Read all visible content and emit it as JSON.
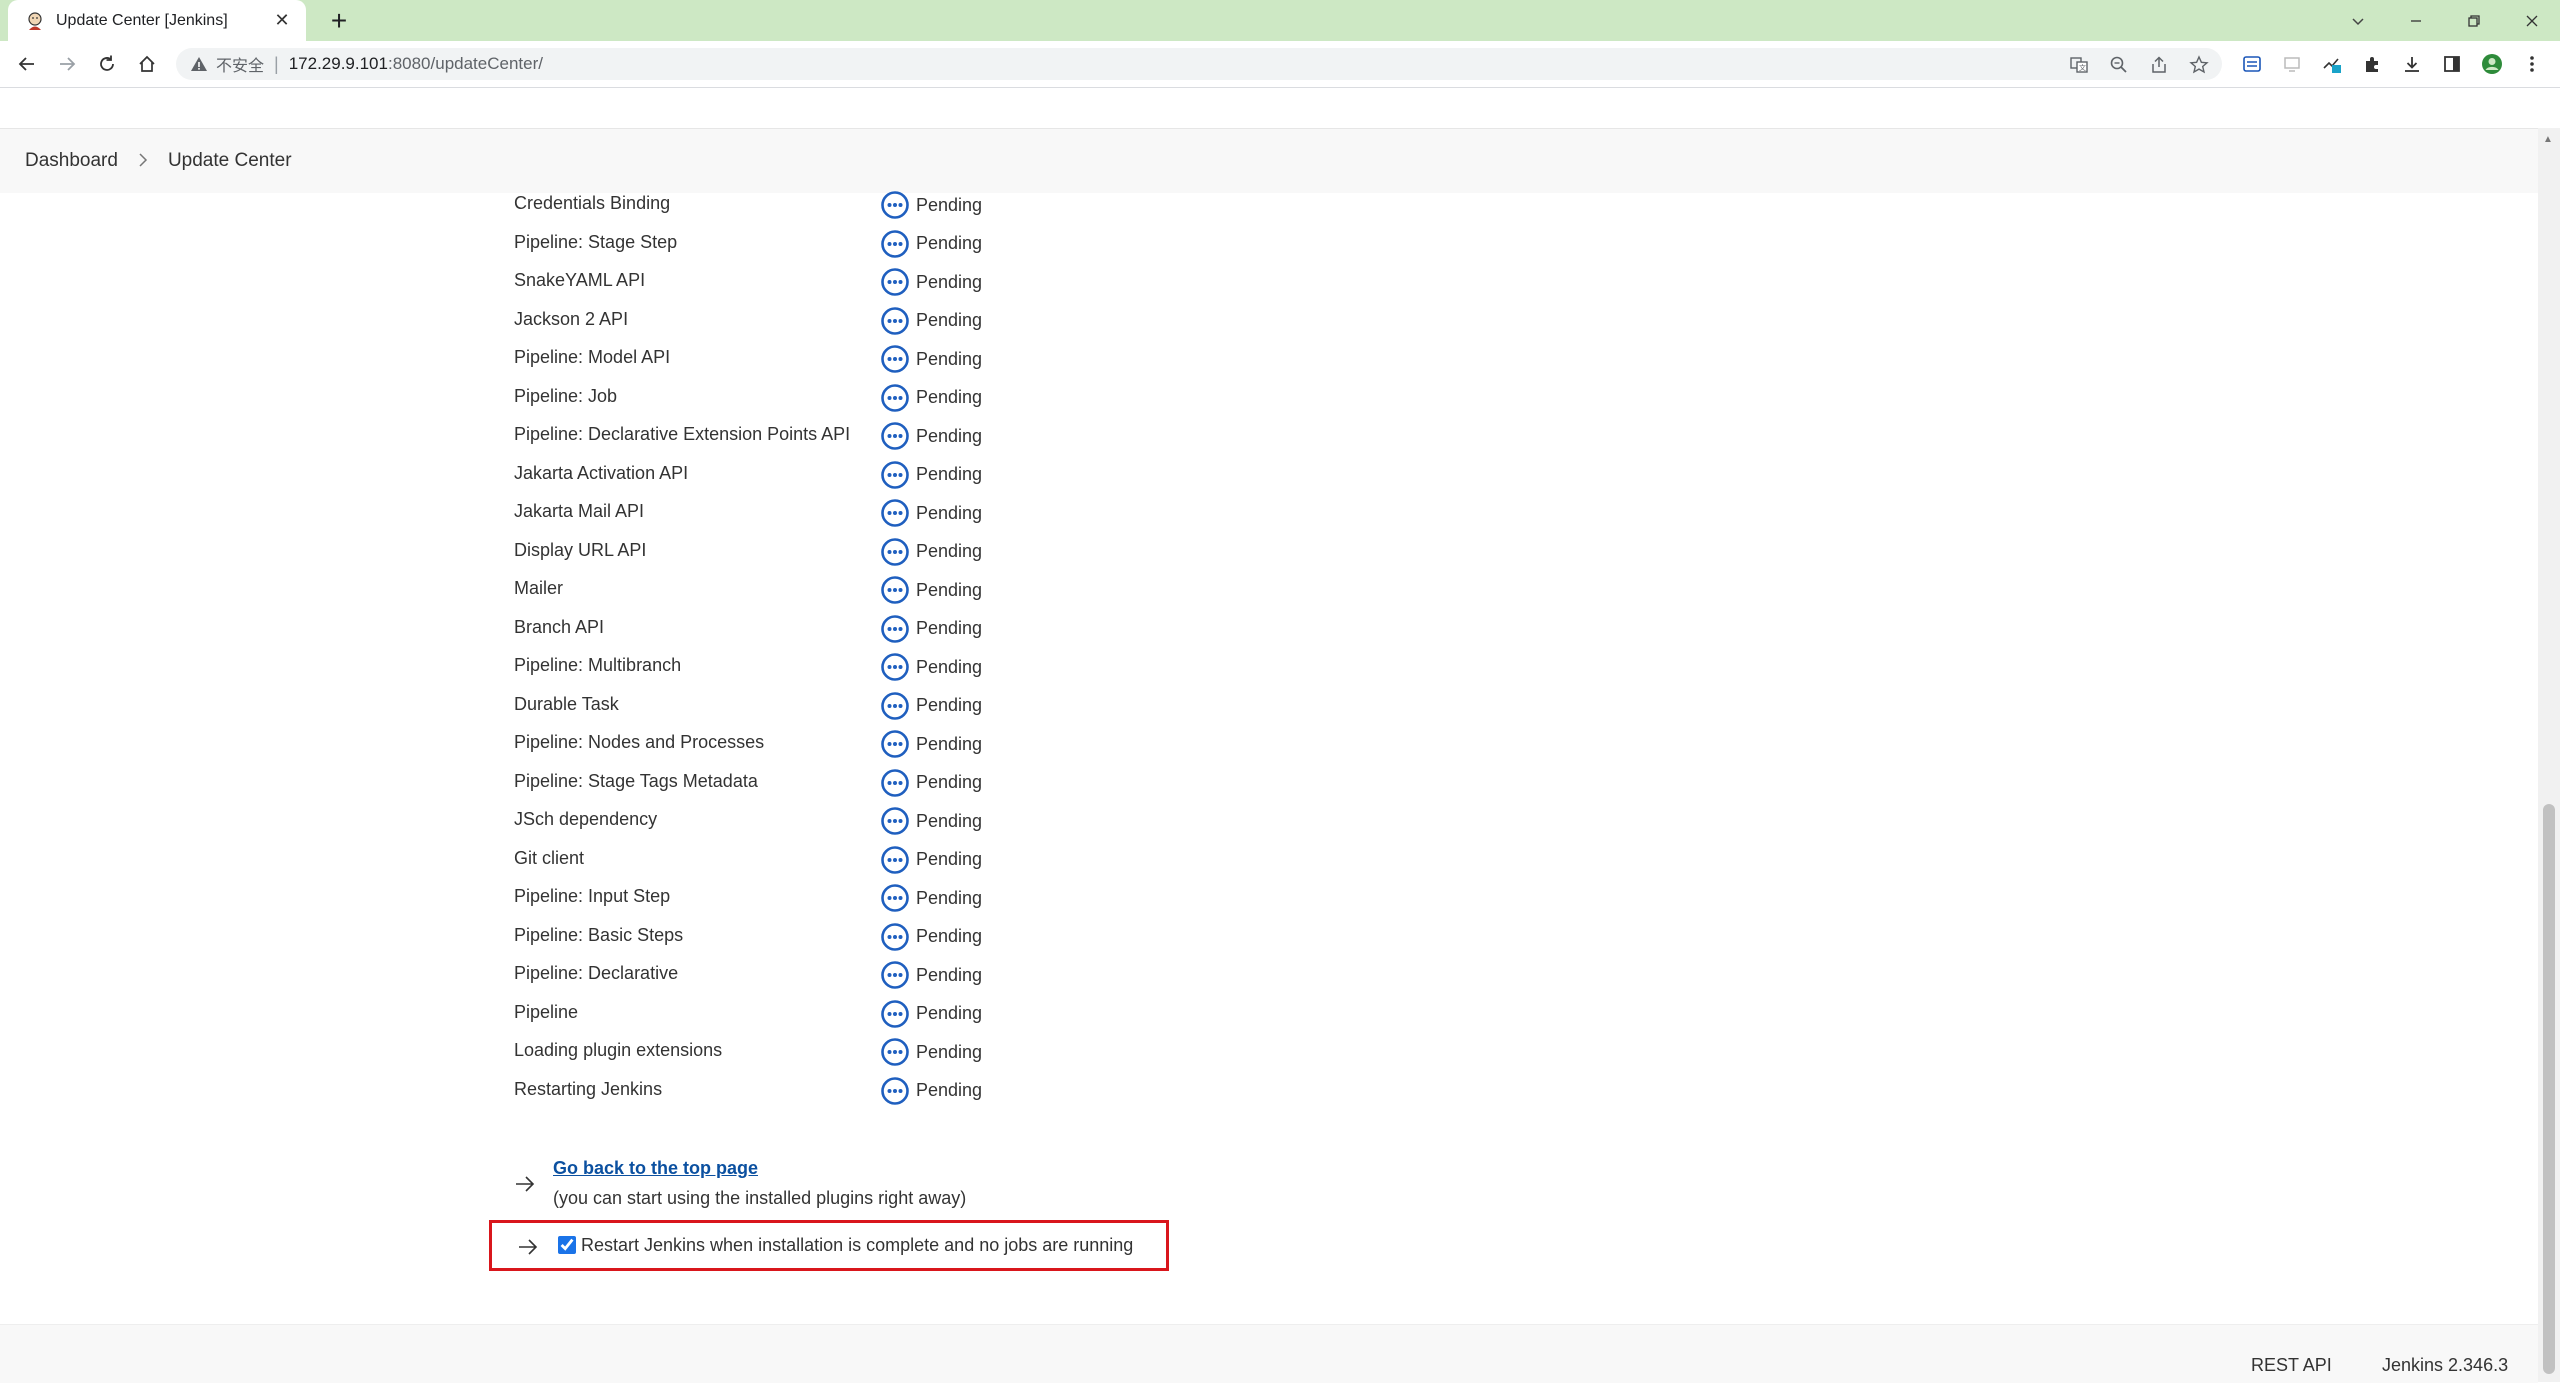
{
  "browser": {
    "tab_title": "Update Center [Jenkins]",
    "security_label": "不安全",
    "url_host": "172.29.9.101",
    "url_rest": ":8080/updateCenter/"
  },
  "breadcrumb": {
    "items": [
      "Dashboard",
      "Update Center"
    ]
  },
  "plugins": [
    {
      "name": "Credentials Binding",
      "status": "Pending"
    },
    {
      "name": "Pipeline: Stage Step",
      "status": "Pending"
    },
    {
      "name": "SnakeYAML API",
      "status": "Pending"
    },
    {
      "name": "Jackson 2 API",
      "status": "Pending"
    },
    {
      "name": "Pipeline: Model API",
      "status": "Pending"
    },
    {
      "name": "Pipeline: Job",
      "status": "Pending"
    },
    {
      "name": "Pipeline: Declarative Extension Points API",
      "status": "Pending"
    },
    {
      "name": "Jakarta Activation API",
      "status": "Pending"
    },
    {
      "name": "Jakarta Mail API",
      "status": "Pending"
    },
    {
      "name": "Display URL API",
      "status": "Pending"
    },
    {
      "name": "Mailer",
      "status": "Pending"
    },
    {
      "name": "Branch API",
      "status": "Pending"
    },
    {
      "name": "Pipeline: Multibranch",
      "status": "Pending"
    },
    {
      "name": "Durable Task",
      "status": "Pending"
    },
    {
      "name": "Pipeline: Nodes and Processes",
      "status": "Pending"
    },
    {
      "name": "Pipeline: Stage Tags Metadata",
      "status": "Pending"
    },
    {
      "name": "JSch dependency",
      "status": "Pending"
    },
    {
      "name": "Git client",
      "status": "Pending"
    },
    {
      "name": "Pipeline: Input Step",
      "status": "Pending"
    },
    {
      "name": "Pipeline: Basic Steps",
      "status": "Pending"
    },
    {
      "name": "Pipeline: Declarative",
      "status": "Pending"
    },
    {
      "name": "Pipeline",
      "status": "Pending"
    },
    {
      "name": "Loading plugin extensions",
      "status": "Pending"
    },
    {
      "name": "Restarting Jenkins",
      "status": "Pending"
    }
  ],
  "actions": {
    "go_back_label": "Go back to the top page",
    "go_back_hint": "(you can start using the installed plugins right away)",
    "restart_label": "Restart Jenkins when installation is complete and no jobs are running",
    "restart_checked": true
  },
  "footer": {
    "rest_api": "REST API",
    "version": "Jenkins 2.346.3"
  },
  "colors": {
    "pending_icon": "#1f5fbf",
    "highlight_border": "#d9161c",
    "tabstrip": "#cde8c4"
  }
}
